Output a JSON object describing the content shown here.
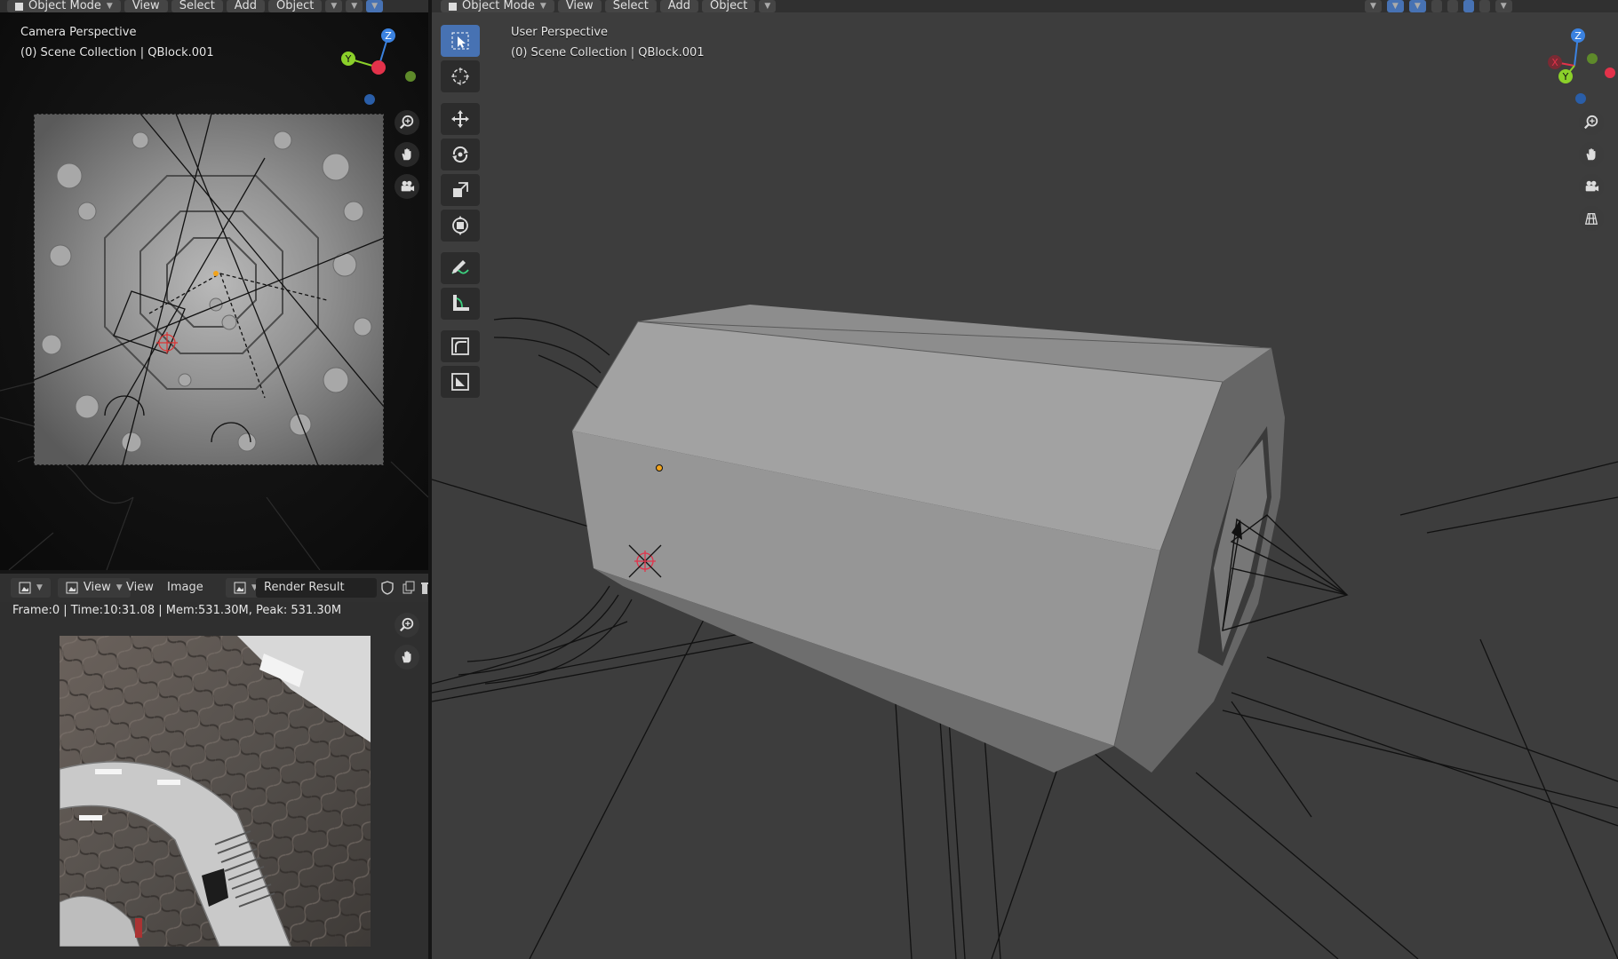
{
  "left_header": {
    "mode_label": "Object Mode",
    "menu": [
      "View",
      "Select",
      "Add",
      "Object"
    ]
  },
  "right_header": {
    "mode_label": "Object Mode",
    "menu": [
      "View",
      "Select",
      "Add",
      "Object"
    ]
  },
  "camera_view": {
    "title": "Camera Perspective",
    "collection": "(0) Scene Collection | QBlock.001"
  },
  "user_view": {
    "title": "User Perspective",
    "collection": "(0) Scene Collection | QBlock.001"
  },
  "image_editor": {
    "view_dropdown": "View",
    "menu": [
      "View",
      "Image"
    ],
    "image_name": "Render Result",
    "status": "Frame:0 | Time:10:31.08 | Mem:531.30M, Peak: 531.30M"
  },
  "gizmo_labels": {
    "x": "X",
    "y": "Y",
    "z": "Z"
  },
  "colors": {
    "x_axis": "#e3324a",
    "y_axis": "#8bd02a",
    "z_axis": "#3b82e0",
    "active_tool": "#4772b3",
    "origin": "#f2a31b"
  },
  "tools": [
    "select-box-icon",
    "cursor-icon",
    "move-icon",
    "rotate-icon",
    "scale-icon",
    "transform-icon",
    "annotate-icon",
    "measure-icon",
    "add-cube-icon",
    "add-shape-icon"
  ]
}
